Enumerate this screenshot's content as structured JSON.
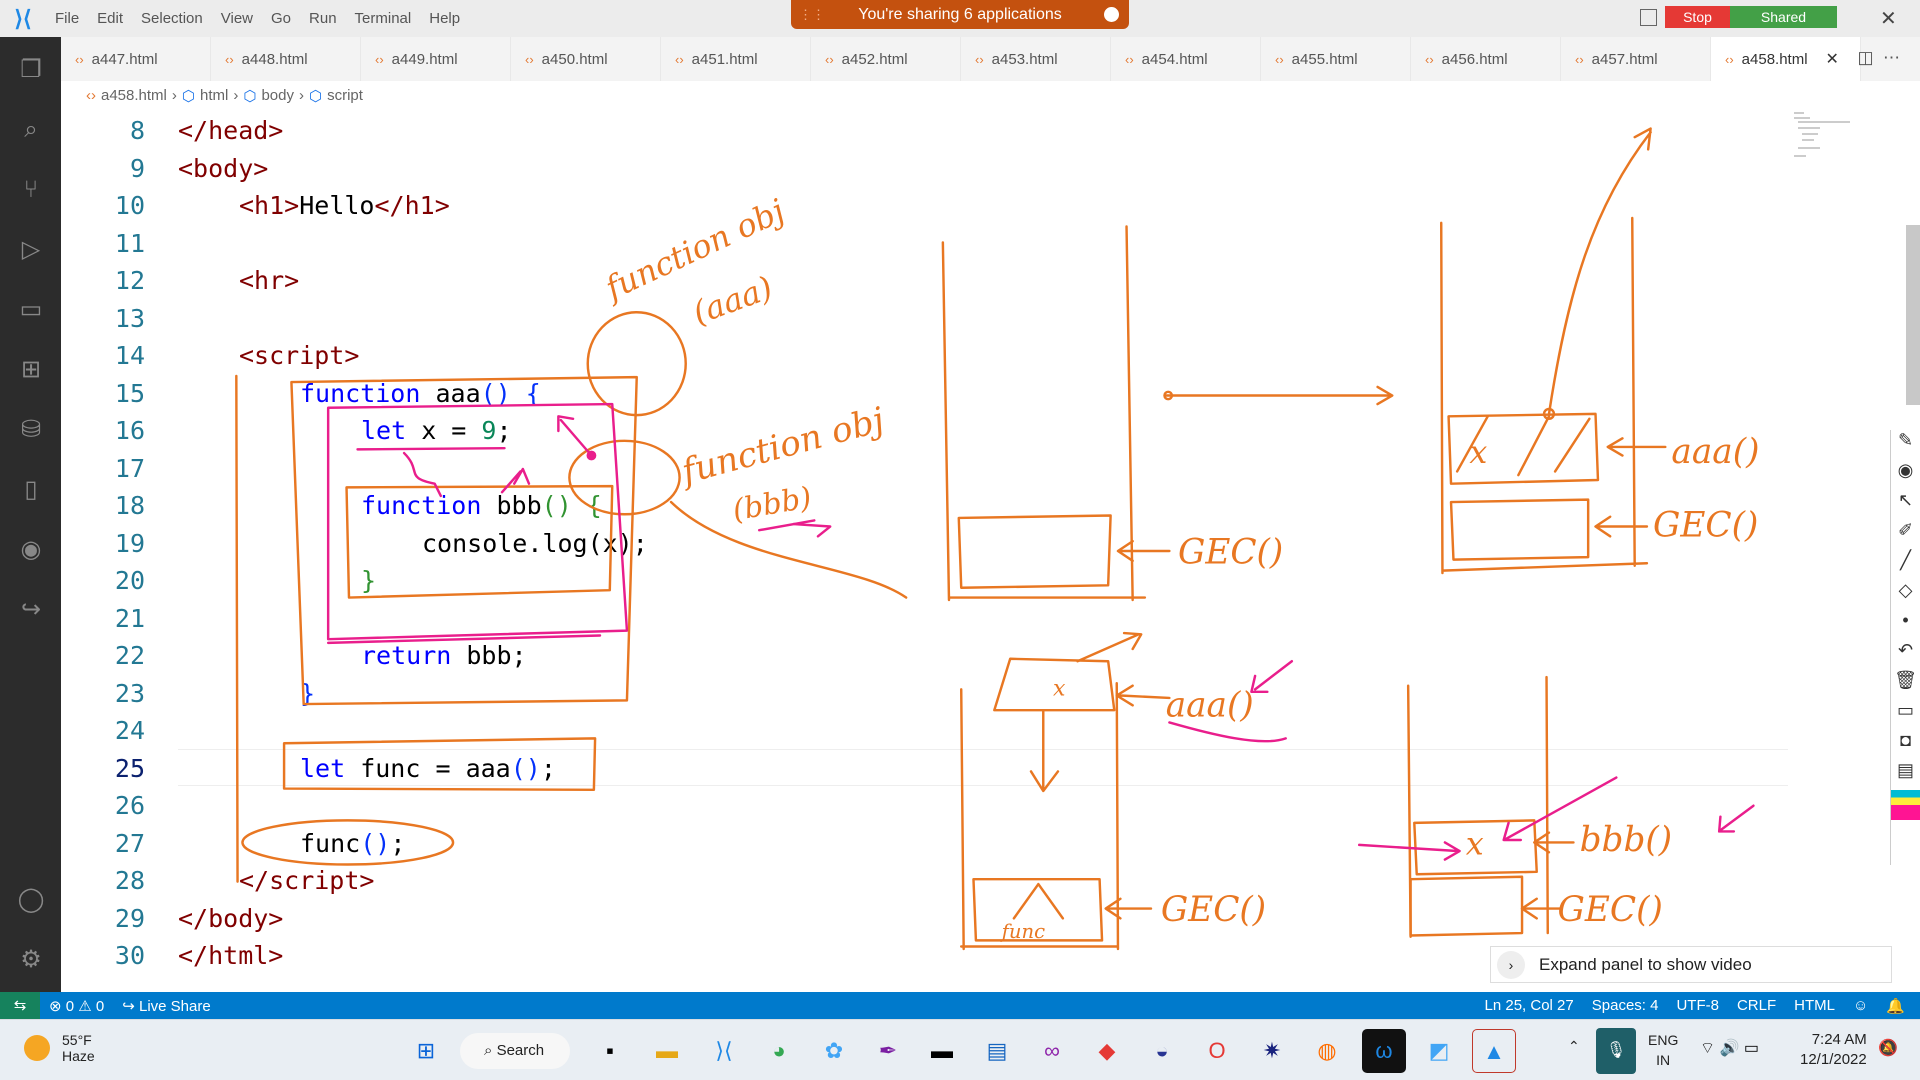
{
  "menu": [
    "File",
    "Edit",
    "Selection",
    "View",
    "Go",
    "Run",
    "Terminal",
    "Help"
  ],
  "share_banner": "You're sharing 6 applications",
  "share_stop": "Stop",
  "share_shared": "Shared",
  "tabs": [
    "a447.html",
    "a448.html",
    "a449.html",
    "a450.html",
    "a451.html",
    "a452.html",
    "a453.html",
    "a454.html",
    "a455.html",
    "a456.html",
    "a457.html",
    "a458.html"
  ],
  "active_tab": "a458.html",
  "breadcrumb": [
    "a458.html",
    "html",
    "body",
    "script"
  ],
  "code": [
    {
      "n": 8,
      "i": 0,
      "t": [
        [
          "</head>",
          "tag"
        ]
      ]
    },
    {
      "n": 9,
      "i": 0,
      "t": [
        [
          "<body>",
          "tag"
        ]
      ]
    },
    {
      "n": 10,
      "i": 1,
      "t": [
        [
          "<h1>",
          "tag"
        ],
        [
          "Hello",
          "pl"
        ],
        [
          "</h1>",
          "tag"
        ]
      ]
    },
    {
      "n": 11,
      "i": 0,
      "t": []
    },
    {
      "n": 12,
      "i": 1,
      "t": [
        [
          "<hr>",
          "tag"
        ]
      ]
    },
    {
      "n": 13,
      "i": 0,
      "t": []
    },
    {
      "n": 14,
      "i": 1,
      "t": [
        [
          "<script>",
          "tag"
        ]
      ]
    },
    {
      "n": 15,
      "i": 2,
      "t": [
        [
          "function",
          "kw"
        ],
        [
          " aaa",
          "pl"
        ],
        [
          "() {",
          "br"
        ]
      ]
    },
    {
      "n": 16,
      "i": 3,
      "t": [
        [
          "let",
          "kw"
        ],
        [
          " x = ",
          "pl"
        ],
        [
          "9",
          "nm"
        ],
        [
          ";",
          "pl"
        ]
      ]
    },
    {
      "n": 17,
      "i": 0,
      "t": []
    },
    {
      "n": 18,
      "i": 3,
      "t": [
        [
          "function",
          "kw"
        ],
        [
          " bbb",
          "pl"
        ],
        [
          "() {",
          "br2"
        ]
      ]
    },
    {
      "n": 19,
      "i": 4,
      "t": [
        [
          "console.log(x);",
          "pl"
        ]
      ]
    },
    {
      "n": 20,
      "i": 3,
      "t": [
        [
          "}",
          "br2"
        ]
      ]
    },
    {
      "n": 21,
      "i": 0,
      "t": []
    },
    {
      "n": 22,
      "i": 3,
      "t": [
        [
          "return",
          "kw"
        ],
        [
          " bbb;",
          "pl"
        ]
      ]
    },
    {
      "n": 23,
      "i": 2,
      "t": [
        [
          "}",
          "br"
        ]
      ]
    },
    {
      "n": 24,
      "i": 0,
      "t": []
    },
    {
      "n": 25,
      "i": 2,
      "t": [
        [
          "let",
          "kw"
        ],
        [
          " func = aaa",
          "pl"
        ],
        [
          "()",
          "br"
        ],
        [
          ";",
          "pl"
        ]
      ]
    },
    {
      "n": 26,
      "i": 0,
      "t": []
    },
    {
      "n": 27,
      "i": 2,
      "t": [
        [
          "func",
          "pl"
        ],
        [
          "()",
          "br"
        ],
        [
          ";",
          "pl"
        ]
      ]
    },
    {
      "n": 28,
      "i": 1,
      "t": [
        [
          "</script>",
          "tag"
        ]
      ]
    },
    {
      "n": 29,
      "i": 0,
      "t": [
        [
          "</body>",
          "tag"
        ]
      ]
    },
    {
      "n": 30,
      "i": 0,
      "t": [
        [
          "</html>",
          "tag"
        ]
      ]
    }
  ],
  "current_line": 25,
  "ink": {
    "fobj_aaa_1": "function obj",
    "fobj_aaa_2": "(aaa)",
    "fobj_bbb_1": "function obj",
    "fobj_bbb_2": "(bbb)",
    "gec1": "GEC()",
    "gec2": "GEC()",
    "gec3": "GEC()",
    "gec4": "GEC()",
    "aaa1": "aaa()",
    "aaa2": "aaa()",
    "bbb": "bbb()",
    "x1": "x",
    "x2": "x",
    "x3": "x",
    "func": "func"
  },
  "expand_panel": "Expand panel to show video",
  "status": {
    "errors": "0",
    "warnings": "0",
    "live_share": "Live Share",
    "position": "Ln 25, Col 27",
    "spaces": "Spaces: 4",
    "encoding": "UTF-8",
    "eol": "CRLF",
    "language": "HTML"
  },
  "taskbar": {
    "temp": "55°F",
    "weather": "Haze",
    "search": "Search",
    "lang1": "ENG",
    "lang2": "IN",
    "time": "7:24 AM",
    "date": "12/1/2022"
  },
  "colors": {
    "ink_orange": "#e87722",
    "ink_pink": "#e91e8c",
    "status_blue": "#007acc"
  }
}
